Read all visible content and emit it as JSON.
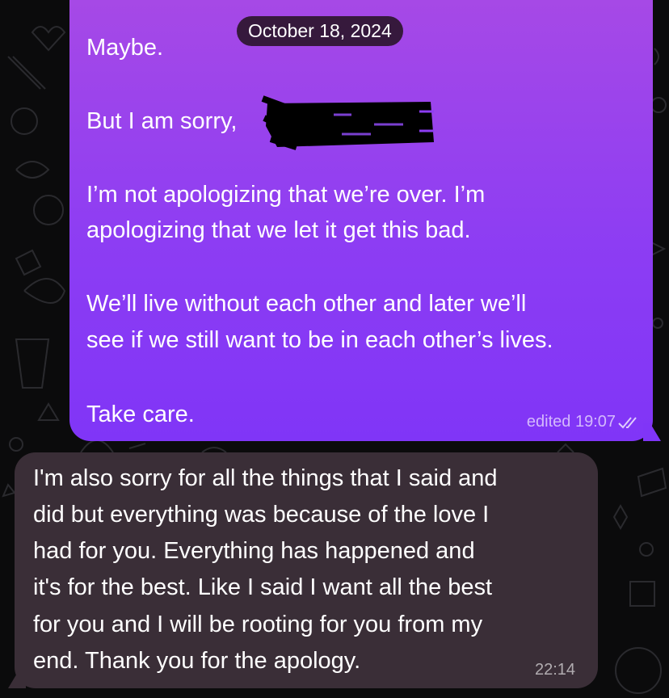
{
  "date_header": "October 18, 2024",
  "outgoing_message": {
    "lines": [
      "Maybe.",
      "But I am sorry,",
      "I’m not apologizing that we’re over. I’m",
      "apologizing that we let it get this bad.",
      "We’ll live without each other and later we’ll",
      "see if we still want to be in each other’s lives.",
      "Take care."
    ],
    "status": "edited 19:07",
    "read_icon": "double-check-icon"
  },
  "incoming_message": {
    "lines": [
      "I'm also sorry for all the things that I said and",
      "did but everything was because of the love I",
      "had for you. Everything has happened and",
      "it's for the best. Like I said I want all the best",
      "for you and I will be rooting  for you from my",
      "end. Thank you for the apology."
    ],
    "time": "22:14"
  },
  "colors": {
    "background": "#0b0b0c",
    "outgoing_bubble_top": "#a649e6",
    "outgoing_bubble_bottom": "#8035f7",
    "incoming_bubble": "#3a2e37"
  }
}
